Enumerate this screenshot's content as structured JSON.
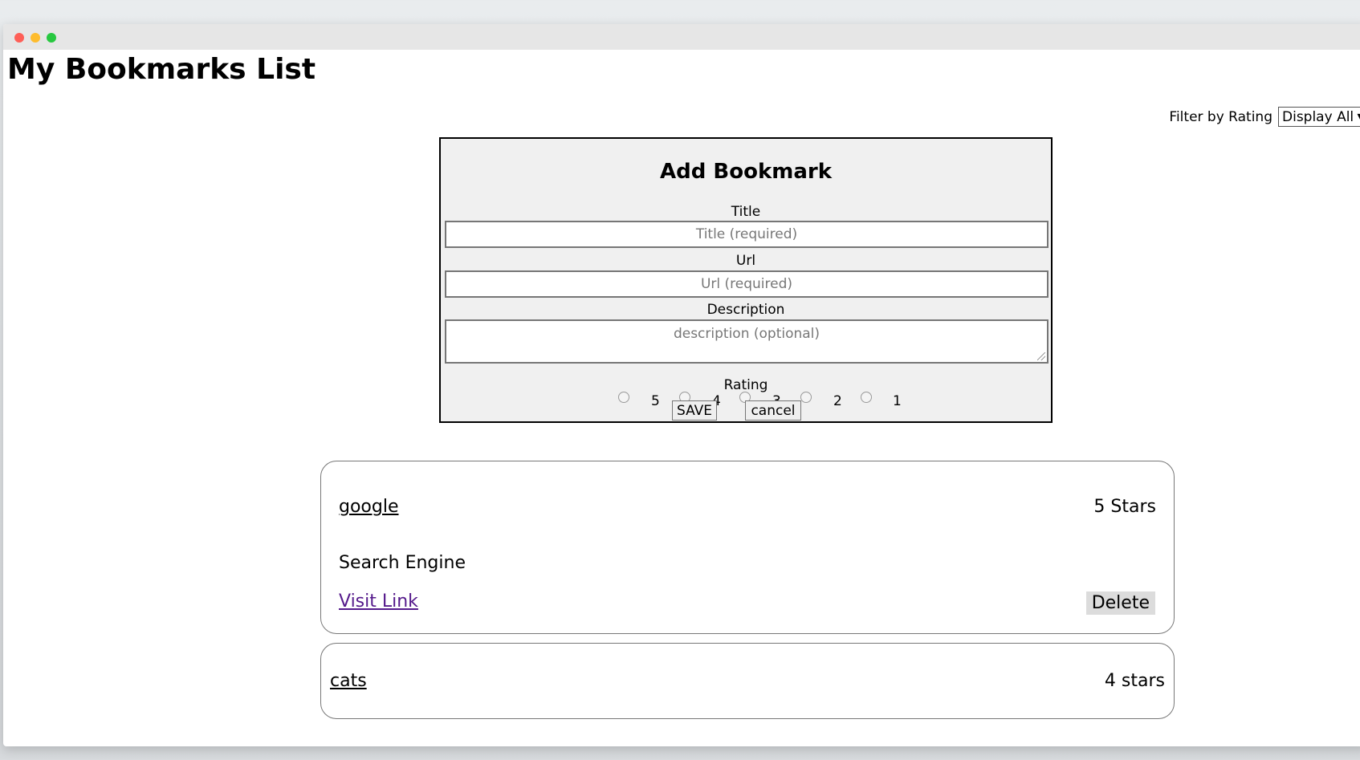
{
  "page": {
    "title": "My Bookmarks List"
  },
  "filter": {
    "label": "Filter by Rating",
    "selected": "Display All"
  },
  "form": {
    "heading": "Add Bookmark",
    "title_label": "Title",
    "title_placeholder": "Title (required)",
    "url_label": "Url",
    "url_placeholder": "Url (required)",
    "description_label": "Description",
    "description_placeholder": "description (optional)",
    "rating_label": "Rating",
    "rating_options": [
      "5",
      "4",
      "3",
      "2",
      "1"
    ],
    "save_label": "SAVE",
    "cancel_label": "cancel"
  },
  "bookmarks": [
    {
      "title": "google",
      "rating": "5 Stars",
      "description": "Search Engine",
      "visit_label": "Visit Link",
      "delete_label": "Delete"
    },
    {
      "title": "cats",
      "rating": "4 stars"
    }
  ],
  "colors": {
    "form_background": "#f0f0f0",
    "visited_link": "#551a8b",
    "delete_background": "#dcdcdc"
  },
  "icons": [
    "close-window-icon",
    "minimize-window-icon",
    "maximize-window-icon",
    "dropdown-arrow-icon",
    "resize-grip-icon"
  ]
}
